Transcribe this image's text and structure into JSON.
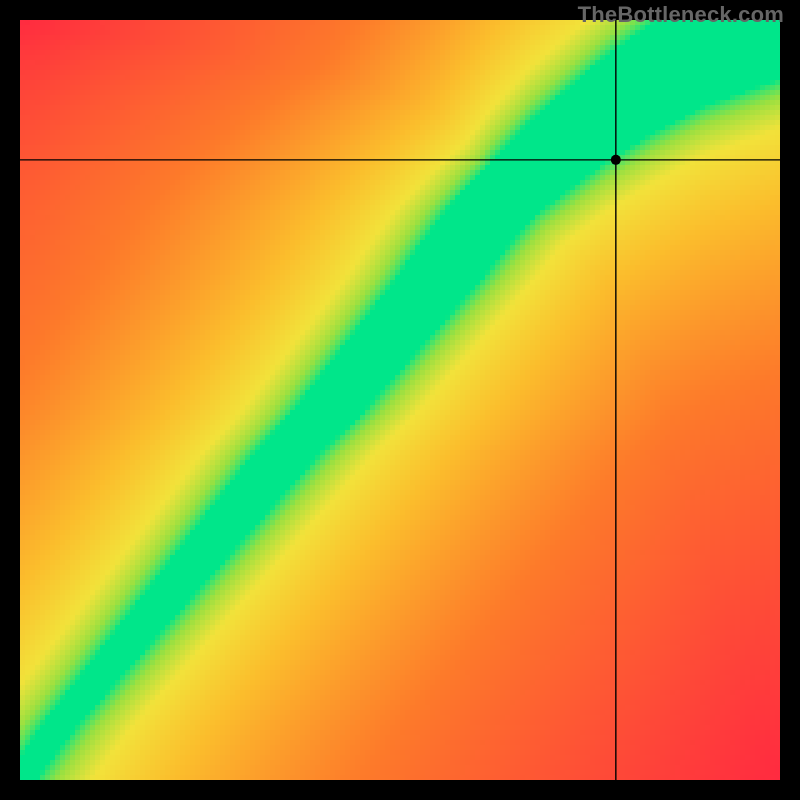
{
  "watermark_text": "TheBottleneck.com",
  "chart_data": {
    "type": "heatmap",
    "title": "",
    "xlabel": "",
    "ylabel": "",
    "xlim": [
      0,
      100
    ],
    "ylim": [
      0,
      100
    ],
    "colorbar": null,
    "note": "Values depict a compatibility/balance score. Green band marks the ideal pairing curve; red = far from ideal; yellow = transitional. A black crosshair marks a selected point.",
    "marker": {
      "x": 78.4,
      "y": 81.6
    },
    "ideal_curve_samples": [
      {
        "x": 0,
        "y": 0
      },
      {
        "x": 5,
        "y": 7
      },
      {
        "x": 10,
        "y": 13
      },
      {
        "x": 15,
        "y": 19
      },
      {
        "x": 20,
        "y": 25
      },
      {
        "x": 25,
        "y": 31
      },
      {
        "x": 30,
        "y": 37
      },
      {
        "x": 35,
        "y": 43
      },
      {
        "x": 40,
        "y": 48
      },
      {
        "x": 45,
        "y": 54
      },
      {
        "x": 50,
        "y": 60
      },
      {
        "x": 55,
        "y": 66
      },
      {
        "x": 58,
        "y": 70
      },
      {
        "x": 62,
        "y": 75
      },
      {
        "x": 67,
        "y": 80
      },
      {
        "x": 72,
        "y": 84
      },
      {
        "x": 77,
        "y": 88
      },
      {
        "x": 83,
        "y": 92
      },
      {
        "x": 90,
        "y": 96
      },
      {
        "x": 100,
        "y": 100
      }
    ],
    "band_halfwidth_fraction_near_origin": 0.02,
    "band_halfwidth_fraction_far": 0.08,
    "color_scale": [
      {
        "d": 0.0,
        "color": "#00e68a"
      },
      {
        "d": 0.08,
        "color": "#9be040"
      },
      {
        "d": 0.16,
        "color": "#f2e23a"
      },
      {
        "d": 0.3,
        "color": "#fbbd2c"
      },
      {
        "d": 0.55,
        "color": "#fd7a2a"
      },
      {
        "d": 1.0,
        "color": "#ff2a40"
      }
    ]
  }
}
